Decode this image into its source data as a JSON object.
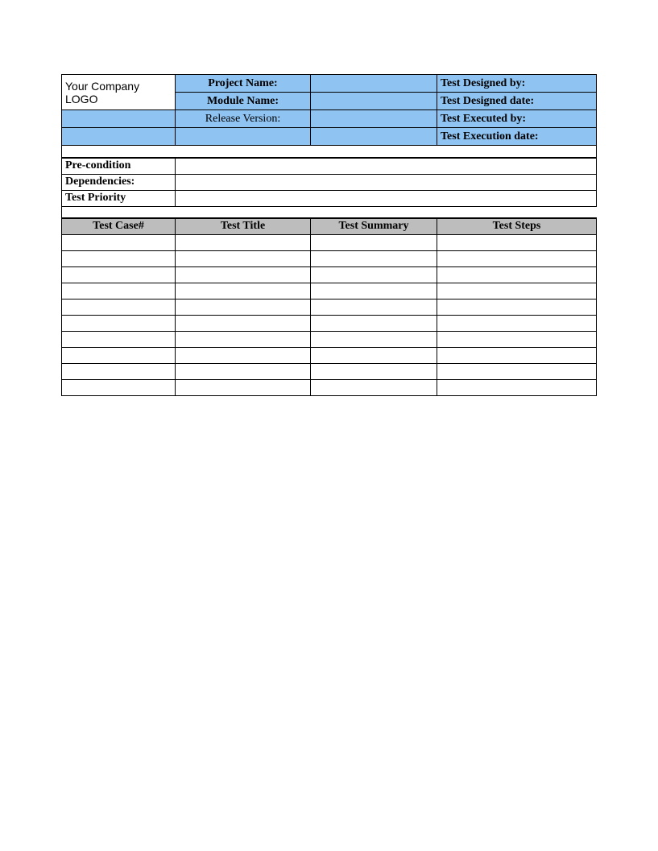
{
  "header": {
    "logo_text": "Your Company LOGO",
    "project_name_label": "Project Name:",
    "project_name_value": "",
    "module_name_label": "Module Name:",
    "module_name_value": "",
    "release_version_label": "Release Version:",
    "release_version_value": "",
    "designed_by_label": "Test Designed by:",
    "designed_by_value": "",
    "designed_date_label": "Test Designed date:",
    "designed_date_value": "",
    "executed_by_label": "Test Executed by:",
    "executed_by_value": "",
    "execution_date_label": "Test Execution date:",
    "execution_date_value": ""
  },
  "meta": {
    "precondition_label": "Pre-condition",
    "precondition_value": "",
    "dependencies_label": "Dependencies:",
    "dependencies_value": "",
    "priority_label": "Test Priority",
    "priority_value": ""
  },
  "grid": {
    "columns": [
      "Test Case#",
      "Test Title",
      "Test Summary",
      "Test Steps"
    ],
    "rows": [
      [
        "",
        "",
        "",
        ""
      ],
      [
        "",
        "",
        "",
        ""
      ],
      [
        "",
        "",
        "",
        ""
      ],
      [
        "",
        "",
        "",
        ""
      ],
      [
        "",
        "",
        "",
        ""
      ],
      [
        "",
        "",
        "",
        ""
      ],
      [
        "",
        "",
        "",
        ""
      ],
      [
        "",
        "",
        "",
        ""
      ],
      [
        "",
        "",
        "",
        ""
      ],
      [
        "",
        "",
        "",
        ""
      ]
    ]
  }
}
